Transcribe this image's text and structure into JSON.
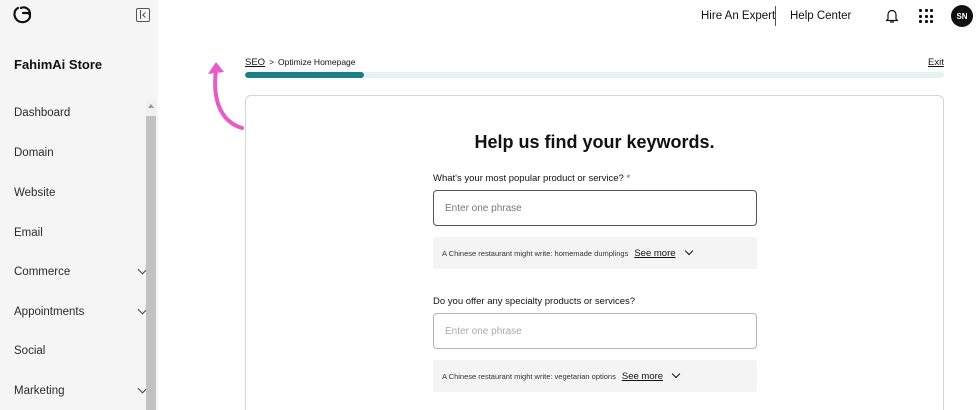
{
  "sidebar": {
    "store_name": "FahimAi Store",
    "items": [
      {
        "label": "Dashboard"
      },
      {
        "label": "Domain"
      },
      {
        "label": "Website"
      },
      {
        "label": "Email"
      },
      {
        "label": "Commerce"
      },
      {
        "label": "Appointments"
      },
      {
        "label": "Social"
      },
      {
        "label": "Marketing"
      }
    ]
  },
  "header": {
    "hire_expert": "Hire An Expert",
    "help_center": "Help Center",
    "avatar_initials": "SN"
  },
  "breadcrumb": {
    "parent": "SEO",
    "separator": ">",
    "current": "Optimize Homepage"
  },
  "exit_label": "Exit",
  "progress": {
    "fraction": 0.17,
    "color": "#1c7f86"
  },
  "card": {
    "title": "Help us find your keywords.",
    "questions": [
      {
        "label": "What's your most popular product or service?",
        "required_mark": "*",
        "placeholder": "Enter one phrase",
        "hint": "A Chinese restaurant might write: homemade dumplings",
        "see_more": "See more"
      },
      {
        "label": "Do you offer any specialty products or services?",
        "placeholder": "Enter one phrase",
        "hint": "A Chinese restaurant might write: vegetarian options",
        "see_more": "See more"
      }
    ]
  },
  "colors": {
    "accent": "#1c7f86",
    "annotation_arrow": "#e85bc6",
    "required": "#d3233f"
  },
  "icons": [
    "logo-icon",
    "collapse-sidebar-icon",
    "bell-icon",
    "apps-grid-icon",
    "chevron-down-icon",
    "scroll-up-arrow-icon"
  ]
}
